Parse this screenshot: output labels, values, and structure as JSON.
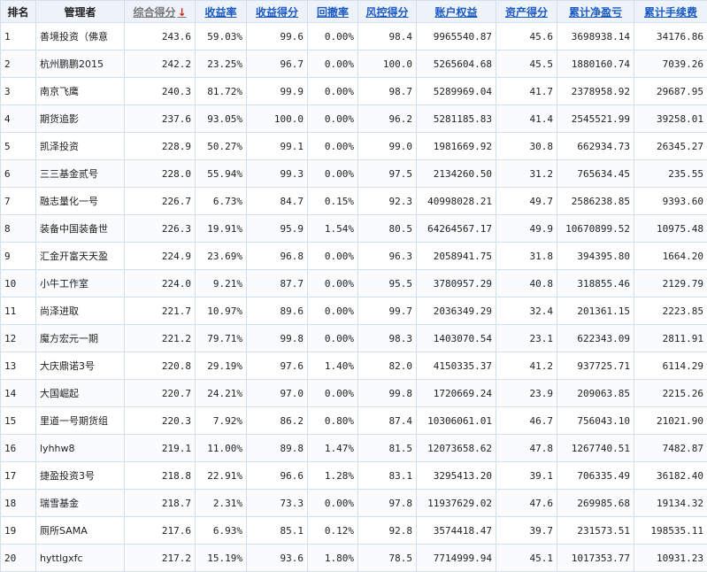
{
  "columns": [
    {
      "label": "排名",
      "key": "rank"
    },
    {
      "label": "管理者",
      "key": "manager"
    },
    {
      "label": "综合得分",
      "key": "score",
      "sort_icon": "down-arrow-icon",
      "arrow": "↓"
    },
    {
      "label": "收益率",
      "key": "return_rate"
    },
    {
      "label": "收益得分",
      "key": "return_score"
    },
    {
      "label": "回撤率",
      "key": "drawdown"
    },
    {
      "label": "风控得分",
      "key": "risk_score"
    },
    {
      "label": "账户权益",
      "key": "equity"
    },
    {
      "label": "资产得分",
      "key": "asset_score"
    },
    {
      "label": "累计净盈亏",
      "key": "net_pnl"
    },
    {
      "label": "累计手续费",
      "key": "fees"
    }
  ],
  "rows": [
    {
      "rank": "1",
      "manager": "善境投资（佛意",
      "score": "243.6",
      "return_rate": "59.03%",
      "return_score": "99.6",
      "drawdown": "0.00%",
      "risk_score": "98.4",
      "equity": "9965540.87",
      "asset_score": "45.6",
      "net_pnl": "3698938.14",
      "fees": "34176.86"
    },
    {
      "rank": "2",
      "manager": "杭州鹏鹏2015",
      "score": "242.2",
      "return_rate": "23.25%",
      "return_score": "96.7",
      "drawdown": "0.00%",
      "risk_score": "100.0",
      "equity": "5265604.68",
      "asset_score": "45.5",
      "net_pnl": "1880160.74",
      "fees": "7039.26"
    },
    {
      "rank": "3",
      "manager": "南京飞鹰",
      "score": "240.3",
      "return_rate": "81.72%",
      "return_score": "99.9",
      "drawdown": "0.00%",
      "risk_score": "98.7",
      "equity": "5289969.04",
      "asset_score": "41.7",
      "net_pnl": "2378958.92",
      "fees": "29687.95"
    },
    {
      "rank": "4",
      "manager": "期货追影",
      "score": "237.6",
      "return_rate": "93.05%",
      "return_score": "100.0",
      "drawdown": "0.00%",
      "risk_score": "96.2",
      "equity": "5281185.83",
      "asset_score": "41.4",
      "net_pnl": "2545521.99",
      "fees": "39258.01"
    },
    {
      "rank": "5",
      "manager": "凯泽投资",
      "score": "228.9",
      "return_rate": "50.27%",
      "return_score": "99.1",
      "drawdown": "0.00%",
      "risk_score": "99.0",
      "equity": "1981669.92",
      "asset_score": "30.8",
      "net_pnl": "662934.73",
      "fees": "26345.27"
    },
    {
      "rank": "6",
      "manager": "三三基金贰号",
      "score": "228.0",
      "return_rate": "55.94%",
      "return_score": "99.3",
      "drawdown": "0.00%",
      "risk_score": "97.5",
      "equity": "2134260.50",
      "asset_score": "31.2",
      "net_pnl": "765634.45",
      "fees": "235.55"
    },
    {
      "rank": "7",
      "manager": "融志量化一号",
      "score": "226.7",
      "return_rate": "6.73%",
      "return_score": "84.7",
      "drawdown": "0.15%",
      "risk_score": "92.3",
      "equity": "40998028.21",
      "asset_score": "49.7",
      "net_pnl": "2586238.85",
      "fees": "9393.60"
    },
    {
      "rank": "8",
      "manager": "装备中国装备世",
      "score": "226.3",
      "return_rate": "19.91%",
      "return_score": "95.9",
      "drawdown": "1.54%",
      "risk_score": "80.5",
      "equity": "64264567.17",
      "asset_score": "49.9",
      "net_pnl": "10670899.52",
      "fees": "10975.48"
    },
    {
      "rank": "9",
      "manager": "汇金开富天天盈",
      "score": "224.9",
      "return_rate": "23.69%",
      "return_score": "96.8",
      "drawdown": "0.00%",
      "risk_score": "96.3",
      "equity": "2058941.75",
      "asset_score": "31.8",
      "net_pnl": "394395.80",
      "fees": "1664.20"
    },
    {
      "rank": "10",
      "manager": "小牛工作室",
      "score": "224.0",
      "return_rate": "9.21%",
      "return_score": "87.7",
      "drawdown": "0.00%",
      "risk_score": "95.5",
      "equity": "3780957.29",
      "asset_score": "40.8",
      "net_pnl": "318855.46",
      "fees": "2129.79"
    },
    {
      "rank": "11",
      "manager": "尚泽进取",
      "score": "221.7",
      "return_rate": "10.97%",
      "return_score": "89.6",
      "drawdown": "0.00%",
      "risk_score": "99.7",
      "equity": "2036349.29",
      "asset_score": "32.4",
      "net_pnl": "201361.15",
      "fees": "2223.85"
    },
    {
      "rank": "12",
      "manager": "魔方宏元一期",
      "score": "221.2",
      "return_rate": "79.71%",
      "return_score": "99.8",
      "drawdown": "0.00%",
      "risk_score": "98.3",
      "equity": "1403070.54",
      "asset_score": "23.1",
      "net_pnl": "622343.09",
      "fees": "2811.91"
    },
    {
      "rank": "13",
      "manager": "大庆鼎诺3号",
      "score": "220.8",
      "return_rate": "29.19%",
      "return_score": "97.6",
      "drawdown": "1.40%",
      "risk_score": "82.0",
      "equity": "4150335.37",
      "asset_score": "41.2",
      "net_pnl": "937725.71",
      "fees": "6114.29"
    },
    {
      "rank": "14",
      "manager": "大国崛起",
      "score": "220.7",
      "return_rate": "24.21%",
      "return_score": "97.0",
      "drawdown": "0.00%",
      "risk_score": "99.8",
      "equity": "1720669.24",
      "asset_score": "23.9",
      "net_pnl": "209063.85",
      "fees": "2215.26"
    },
    {
      "rank": "15",
      "manager": "里道一号期货组",
      "score": "220.3",
      "return_rate": "7.92%",
      "return_score": "86.2",
      "drawdown": "0.80%",
      "risk_score": "87.4",
      "equity": "10306061.01",
      "asset_score": "46.7",
      "net_pnl": "756043.10",
      "fees": "21021.90"
    },
    {
      "rank": "16",
      "manager": "lyhhw8",
      "score": "219.1",
      "return_rate": "11.00%",
      "return_score": "89.8",
      "drawdown": "1.47%",
      "risk_score": "81.5",
      "equity": "12073658.62",
      "asset_score": "47.8",
      "net_pnl": "1267740.51",
      "fees": "7482.87"
    },
    {
      "rank": "17",
      "manager": "捷盈投资3号",
      "score": "218.8",
      "return_rate": "22.91%",
      "return_score": "96.6",
      "drawdown": "1.28%",
      "risk_score": "83.1",
      "equity": "3295413.20",
      "asset_score": "39.1",
      "net_pnl": "706335.49",
      "fees": "36182.40"
    },
    {
      "rank": "18",
      "manager": "瑞雪基金",
      "score": "218.7",
      "return_rate": "2.31%",
      "return_score": "73.3",
      "drawdown": "0.00%",
      "risk_score": "97.8",
      "equity": "11937629.02",
      "asset_score": "47.6",
      "net_pnl": "269985.68",
      "fees": "19134.32"
    },
    {
      "rank": "19",
      "manager": "厕所SAMA",
      "score": "217.6",
      "return_rate": "6.93%",
      "return_score": "85.1",
      "drawdown": "0.12%",
      "risk_score": "92.8",
      "equity": "3574418.47",
      "asset_score": "39.7",
      "net_pnl": "231573.51",
      "fees": "198535.11"
    },
    {
      "rank": "20",
      "manager": "hyttlgxfc",
      "score": "217.2",
      "return_rate": "15.19%",
      "return_score": "93.6",
      "drawdown": "1.80%",
      "risk_score": "78.5",
      "equity": "7714999.94",
      "asset_score": "45.1",
      "net_pnl": "1017353.77",
      "fees": "10931.23"
    }
  ],
  "colors": {
    "link": "#1a59c4",
    "pnl": "#e02020",
    "header_bg": "#eef3fa",
    "border": "#d4dfec"
  }
}
